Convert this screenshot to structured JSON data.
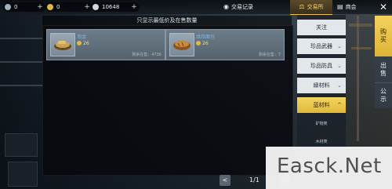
{
  "topbar": {
    "res1_value": "0",
    "res2_value": "0",
    "res3_value": "10648",
    "bag_label": "交易记录",
    "tab_trade": "交易所",
    "tab_shop": "商会",
    "close_symbol": "✕"
  },
  "notice": "只显示最低价及在售数量",
  "listings": [
    {
      "name": "淘金",
      "price": "26",
      "remain": "剩余在售：4736"
    },
    {
      "name": "烘焙面包",
      "price": "26",
      "remain": "剩余在售：7"
    }
  ],
  "pager": {
    "prev": "<",
    "page": "1/1",
    "next": ">"
  },
  "categories": [
    {
      "label": "关注",
      "arrow": ""
    },
    {
      "label": "珍品武器",
      "arrow": "⌄"
    },
    {
      "label": "珍品防具",
      "arrow": "⌄"
    },
    {
      "label": "縁材料",
      "arrow": "⌄"
    },
    {
      "label": "蓝材料",
      "arrow": "^"
    }
  ],
  "subcategories": [
    "矿物类",
    "木材类"
  ],
  "right_tabs": {
    "buy": "购买",
    "sell": "出售",
    "notice": "公示"
  },
  "watermark": "Easck.Net",
  "colors": {
    "accent_gold": "#e0b83a",
    "link_blue": "#7fb8e6"
  }
}
